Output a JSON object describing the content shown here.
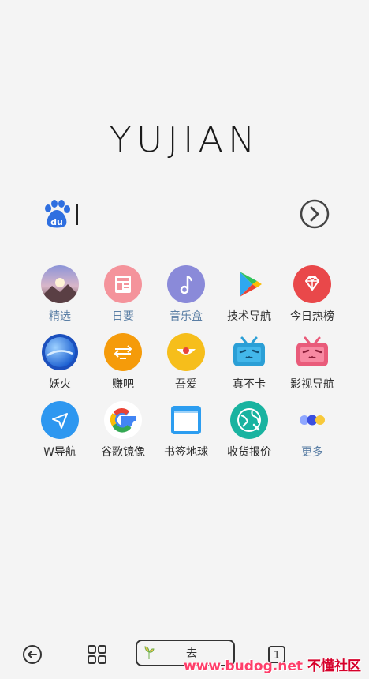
{
  "logo": "YUJIAN",
  "search": {
    "cursor": "I"
  },
  "apps": [
    {
      "label": "精选",
      "icon": "landscape-icon",
      "muted": true
    },
    {
      "label": "日要",
      "icon": "news-icon",
      "muted": true
    },
    {
      "label": "音乐盒",
      "icon": "music-note-icon",
      "muted": true
    },
    {
      "label": "技术导航",
      "icon": "play-store-icon",
      "muted": false
    },
    {
      "label": "今日热榜",
      "icon": "diamond-icon",
      "muted": false
    },
    {
      "label": "妖火",
      "icon": "blue-orb-icon",
      "muted": false
    },
    {
      "label": "赚吧",
      "icon": "orange-arrows-icon",
      "muted": false
    },
    {
      "label": "吾爱",
      "icon": "eye-icon",
      "muted": false
    },
    {
      "label": "真不卡",
      "icon": "bilibili-blue-icon",
      "muted": false
    },
    {
      "label": "影视导航",
      "icon": "bilibili-pink-icon",
      "muted": false
    },
    {
      "label": "W导航",
      "icon": "send-arrow-icon",
      "muted": false
    },
    {
      "label": "谷歌镜像",
      "icon": "google-icon",
      "muted": false
    },
    {
      "label": "书签地球",
      "icon": "bookmark-window-icon",
      "muted": false
    },
    {
      "label": "收货报价",
      "icon": "globe-icon",
      "muted": false
    },
    {
      "label": "更多",
      "icon": "more-dots-icon",
      "muted": true
    }
  ],
  "bottom": {
    "tab_text": "去",
    "tab_count": "1"
  },
  "watermark": {
    "site": "www.budog.net",
    "name": "不懂社区"
  }
}
